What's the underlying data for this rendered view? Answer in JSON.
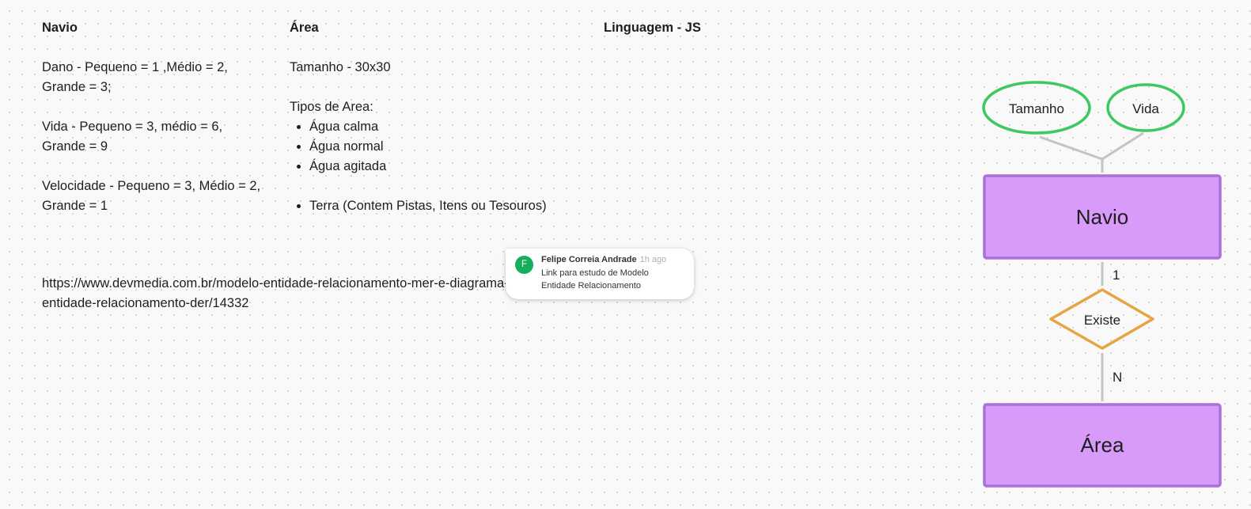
{
  "notes": {
    "navio": {
      "heading": "Navio",
      "dano": "Dano - Pequeno = 1 ,Médio = 2, Grande = 3;",
      "vida": "Vida - Pequeno = 3, médio = 6, Grande = 9",
      "velocidade": "Velocidade - Pequeno = 3, Médio = 2, Grande = 1"
    },
    "area": {
      "heading": "Área",
      "tamanho": "Tamanho - 30x30",
      "tipos_label": "Tipos de Area:",
      "tipos": [
        "Água calma",
        "Água normal",
        "Água agitada"
      ],
      "terra": "Terra (Contem Pistas, Itens ou Tesouros)"
    },
    "linguagem": {
      "heading": "Linguagem - JS"
    },
    "link": "https://www.devmedia.com.br/modelo-entidade-relacionamento-mer-e-diagrama-entidade-relacionamento-der/14332"
  },
  "comment": {
    "initial": "F",
    "author": "Felipe Correia Andrade",
    "time": "1h ago",
    "text": "Link para estudo de Modelo Entidade Relacionamento"
  },
  "diagram": {
    "attributes": [
      "Tamanho",
      "Vida"
    ],
    "entity_top": "Navio",
    "relationship": "Existe",
    "cardinality_top": "1",
    "cardinality_bottom": "N",
    "entity_bottom": "Área",
    "colors": {
      "attribute_stroke": "#3dc862",
      "entity_fill": "#d89bfa",
      "entity_stroke": "#a972d6",
      "relationship_stroke": "#e6a545",
      "connector": "#c4c4c4",
      "avatar": "#14ae5c"
    }
  }
}
